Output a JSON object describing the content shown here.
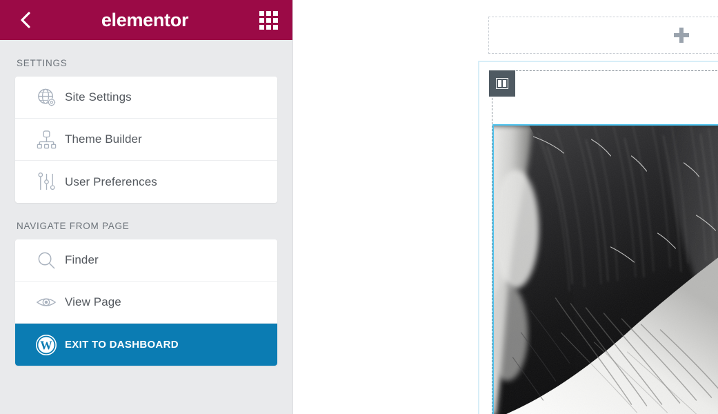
{
  "panel": {
    "header": {
      "back_icon": "chevron-left-icon",
      "logo_text": "elementor",
      "grid_icon": "apps-grid-icon"
    },
    "sections": [
      {
        "label": "SETTINGS",
        "items": [
          {
            "label": "Site Settings",
            "icon": "globe-gear-icon",
            "style": "default"
          },
          {
            "label": "Theme Builder",
            "icon": "sitemap-icon",
            "style": "default"
          },
          {
            "label": "User Preferences",
            "icon": "sliders-icon",
            "style": "default"
          }
        ]
      },
      {
        "label": "NAVIGATE FROM PAGE",
        "items": [
          {
            "label": "Finder",
            "icon": "search-icon",
            "style": "default"
          },
          {
            "label": "View Page",
            "icon": "eye-icon",
            "style": "default"
          },
          {
            "label": "EXIT TO DASHBOARD",
            "icon": "wordpress-icon",
            "style": "primary"
          }
        ]
      }
    ]
  },
  "canvas": {
    "add_section": {
      "icon": "plus-icon",
      "label": ""
    },
    "column_handle": {
      "icon": "two-column-icon"
    },
    "widget": {
      "type": "image",
      "alt": "black and white photo of a horse mane"
    }
  },
  "colors": {
    "brand": "#9b0a46",
    "accent": "#0b7cb3",
    "panel_bg": "#e9eaec",
    "selection": "#4ec3ee",
    "handle": "#4f5a62",
    "icon_gray": "#a3acb8",
    "text_gray": "#54595f"
  }
}
